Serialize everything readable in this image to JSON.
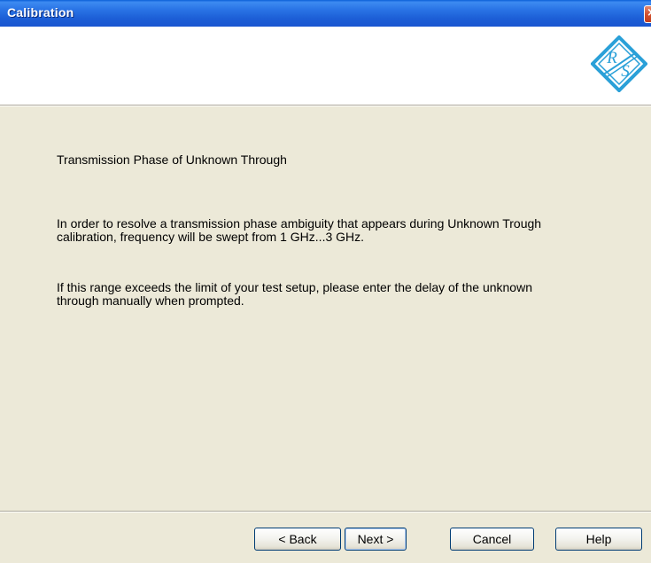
{
  "window": {
    "title": "Calibration"
  },
  "titlebar": {
    "close_icon": "close-icon"
  },
  "header": {
    "logo_icon": "rohde-schwarz-logo-icon",
    "logo_text": "RS"
  },
  "content": {
    "heading": "Transmission Phase of Unknown Through",
    "paragraph1": [
      "In order to resolve a transmission phase ambiguity that appears during Unknown Trough",
      "calibration, frequency will be swept from 1 GHz...3 GHz."
    ],
    "paragraph2": [
      "If this range exceeds the limit of your test setup, please enter the delay of the unknown",
      "through manually when prompted."
    ]
  },
  "buttons": {
    "back": "< Back",
    "next": "Next >",
    "cancel": "Cancel",
    "help": "Help"
  },
  "colors": {
    "titlebar": "#1C5ED6",
    "dialog_bg": "#ECE9D8",
    "logo_blue": "#2AA0D8",
    "close_red": "#D2512F"
  }
}
